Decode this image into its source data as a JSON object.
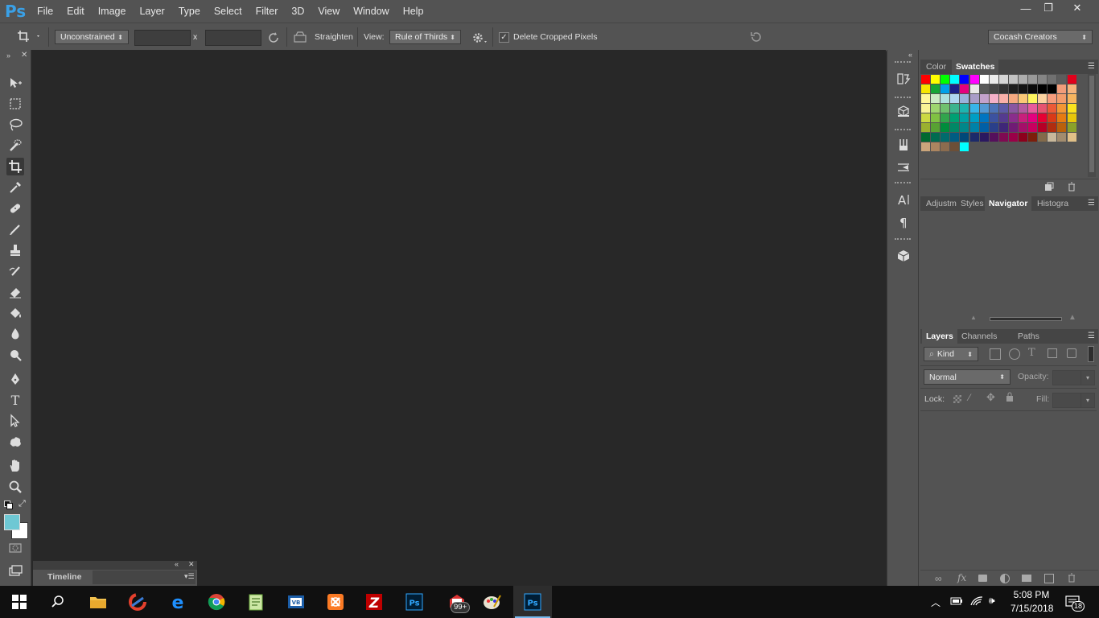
{
  "app": {
    "logo": "Ps"
  },
  "menu": [
    "File",
    "Edit",
    "Image",
    "Layer",
    "Type",
    "Select",
    "Filter",
    "3D",
    "View",
    "Window",
    "Help"
  ],
  "window_controls": {
    "minimize": "—",
    "restore": "❐",
    "close": "✕"
  },
  "options_bar": {
    "ratio_value": "Unconstrained",
    "x_sep": "x",
    "straighten_label": "Straighten",
    "view_label": "View:",
    "view_value": "Rule of Thirds",
    "delete_cropped_label": "Delete Cropped Pixels",
    "delete_cropped_checked": true,
    "workspace_value": "Cocash Creators"
  },
  "colors": {
    "foreground": "#6ec8d4",
    "background": "#ffffff",
    "accent": "#3aa0e6"
  },
  "timeline": {
    "label": "Timeline"
  },
  "color_panel": {
    "tabs": [
      "Color",
      "Swatches"
    ],
    "active_tab": "Swatches",
    "swatches": [
      [
        "#ff0000",
        "#ffff00",
        "#00ff00",
        "#00ffff",
        "#0000ff",
        "#ff00ff",
        "#ffffff",
        "#ebebeb",
        "#d6d6d6",
        "#c2c2c2",
        "#adadad",
        "#999999",
        "#858585",
        "#707070",
        "#5c5c5c",
        "#e0001b"
      ],
      [
        "#f7e600",
        "#16a537",
        "#00a0e9",
        "#1d2088",
        "#e4007f",
        "#e8e8e8",
        "#5a5a5a",
        "#474747",
        "#333333",
        "#1f1f1f",
        "#141414",
        "#0a0a0a",
        "#000000",
        "#000000",
        "#f29c7a",
        "#f7b47c"
      ],
      [
        "#fff799",
        "#ccebc5",
        "#aee0dd",
        "#b0d6f0",
        "#99b3dc",
        "#a89cc8",
        "#c4a2cc",
        "#f4b0c8",
        "#f9b0a9",
        "#f5a980",
        "#fac876",
        "#fff55f",
        "#fbd29f",
        "#f69c7c",
        "#f39c6b",
        "#f8b55f"
      ],
      [
        "#f8f396",
        "#9ed66f",
        "#70c16e",
        "#3cb48e",
        "#1db4b0",
        "#37b5e8",
        "#539ad5",
        "#4d73b8",
        "#5c5aa7",
        "#8957a1",
        "#b45aa0",
        "#e85a9c",
        "#e65470",
        "#ec5a37",
        "#f29734",
        "#fae31e"
      ],
      [
        "#ccd942",
        "#80c242",
        "#32a54d",
        "#00a073",
        "#00a0a3",
        "#009ec4",
        "#0075c0",
        "#3c52a0",
        "#553b8f",
        "#8a2e8c",
        "#c8207c",
        "#e4007f",
        "#e60033",
        "#d93a17",
        "#e57b12",
        "#e7c70b"
      ],
      [
        "#9bb02f",
        "#58a233",
        "#008c3c",
        "#008866",
        "#00878a",
        "#0082a8",
        "#005fa6",
        "#2a3f8a",
        "#3f2678",
        "#711b75",
        "#a50f69",
        "#c8005f",
        "#b50026",
        "#b02d0f",
        "#b9610c",
        "#8aa12a"
      ],
      [
        "#006930",
        "#006b50",
        "#006b6c",
        "#005c82",
        "#004878",
        "#1c2a6a",
        "#2b1860",
        "#55105c",
        "#7f0a52",
        "#9a0048",
        "#8c001c",
        "#7c1e0b",
        "#836a4a",
        "#c8b89b",
        "#a28c6e",
        "#e0c088"
      ],
      [
        "#cba57b",
        "#ab8560",
        "#8b6c4f",
        "#6c4f37",
        "#00ffff"
      ]
    ]
  },
  "nav_panel": {
    "tabs": [
      "Adjustm",
      "Styles",
      "Navigator",
      "Histogra"
    ],
    "active_tab": "Navigator"
  },
  "layers_panel": {
    "tabs": [
      "Layers",
      "Channels",
      "Paths"
    ],
    "active_tab": "Layers",
    "kind_label": "Kind",
    "blend_mode": "Normal",
    "opacity_label": "Opacity:",
    "lock_label": "Lock:",
    "fill_label": "Fill:"
  },
  "taskbar": {
    "time": "5:08 PM",
    "date": "7/15/2018",
    "mail_badge": "99+",
    "notification_badge": "18"
  }
}
